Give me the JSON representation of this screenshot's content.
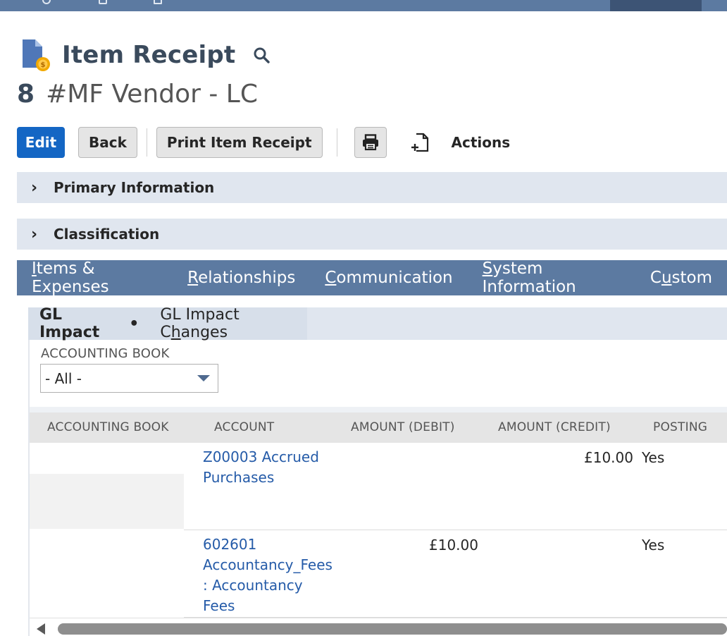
{
  "page": {
    "title": "Item Receipt",
    "record_number": "8",
    "record_name": "#MF Vendor - LC"
  },
  "toolbar": {
    "edit": "Edit",
    "back": "Back",
    "print_item_receipt": "Print Item Receipt",
    "actions": "Actions"
  },
  "sections": [
    {
      "label": "Primary Information"
    },
    {
      "label": "Classification"
    }
  ],
  "tabs": [
    {
      "pre": "",
      "u": "I",
      "post": "tems & Expenses"
    },
    {
      "pre": "",
      "u": "R",
      "post": "elationships"
    },
    {
      "pre": "",
      "u": "C",
      "post": "ommunication"
    },
    {
      "pre": "",
      "u": "S",
      "post": "ystem Information"
    },
    {
      "pre": "C",
      "u": "u",
      "post": "stom"
    }
  ],
  "subtabs": {
    "active": "GL Impact",
    "active_marker": "•",
    "other_pre": "GL Impact C",
    "other_u": "h",
    "other_post": "anges"
  },
  "filter": {
    "label": "ACCOUNTING BOOK",
    "value": "- All -"
  },
  "table": {
    "headers": [
      "ACCOUNTING BOOK",
      "ACCOUNT",
      "AMOUNT (DEBIT)",
      "AMOUNT (CREDIT)",
      "POSTING"
    ],
    "rows": [
      {
        "account_line1": "Z00003 Accrued",
        "account_line2": "Purchases",
        "account_line3": "",
        "account_line4": "",
        "debit": "",
        "credit": "£10.00",
        "posting": "Yes"
      },
      {
        "account_line1": "602601",
        "account_line2": "Accountancy_Fees",
        "account_line3": ": Accountancy",
        "account_line4": "Fees",
        "debit": "£10.00",
        "credit": "",
        "posting": "Yes"
      }
    ]
  },
  "colors": {
    "topbar": "#5c7aa1",
    "primary_button": "#1466c4",
    "section_bg": "#e0e6ef",
    "link": "#255ba8"
  }
}
